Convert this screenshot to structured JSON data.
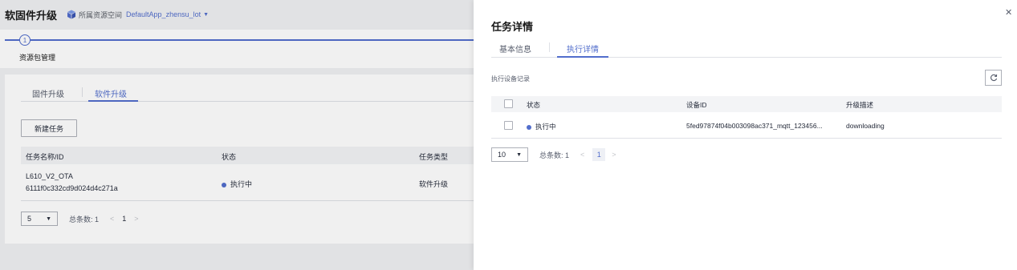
{
  "header": {
    "title": "软固件升级",
    "space_label": "所属资源空间",
    "space_value": "DefaultApp_zhensu_lot"
  },
  "steps": {
    "number": "1",
    "label": "资源包管理"
  },
  "main": {
    "tabs": [
      {
        "label": "固件升级",
        "active": false
      },
      {
        "label": "软件升级",
        "active": true
      }
    ],
    "new_task_label": "新建任务",
    "columns": [
      "任务名称/ID",
      "状态",
      "任务类型"
    ],
    "rows": [
      {
        "name": "L610_V2_OTA",
        "id": "6111f0c332cd9d024d4c271a",
        "status": "执行中",
        "type": "软件升级"
      }
    ],
    "pager": {
      "page_size": "5",
      "total": "总条数: 1",
      "page": "1"
    }
  },
  "drawer": {
    "title": "任务详情",
    "tabs": [
      {
        "label": "基本信息",
        "active": false
      },
      {
        "label": "执行详情",
        "active": true
      }
    ],
    "section_label": "执行设备记录",
    "columns": [
      "状态",
      "设备ID",
      "升级描述"
    ],
    "rows": [
      {
        "status": "执行中",
        "device_id": "5fed97874f04b003098ac371_mqtt_123456...",
        "description": "downloading"
      }
    ],
    "pager": {
      "page_size": "10",
      "total": "总条数: 1",
      "page": "1"
    }
  },
  "colors": {
    "accent": "#526ecc",
    "status_running": "#526ecc"
  },
  "icons": {
    "space": "cube-icon",
    "close": "close-icon",
    "refresh": "refresh-icon",
    "dropdown": "caret-down-icon"
  }
}
